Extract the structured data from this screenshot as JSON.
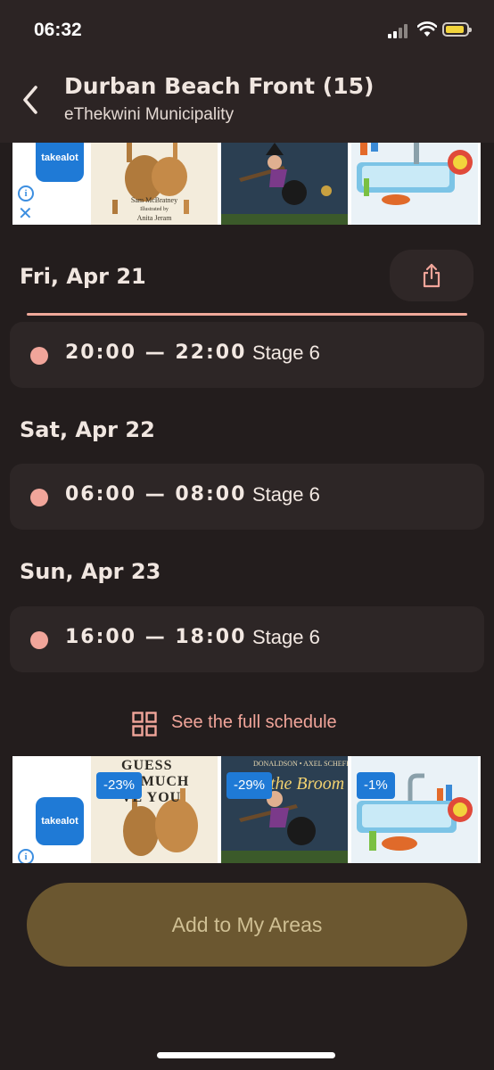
{
  "status_bar": {
    "time": "06:32"
  },
  "header": {
    "title": "Durban Beach Front (15)",
    "subtitle": "eThekwini Municipality"
  },
  "ads": {
    "brand": "takealot",
    "top": {
      "book1_title_lines": [
        "Sam McBratney",
        "Illustrated by",
        "Anita Jeram"
      ]
    },
    "bottom": {
      "book1_title": "GUESS\nW MUCH\nVE YOU",
      "book2_title": "n the Broom",
      "book2_authors": "DONALDSON • AXEL SCHEFFLER",
      "discounts": [
        "-23%",
        "-29%",
        "-1%"
      ]
    }
  },
  "schedule": {
    "days": [
      {
        "label": "Fri, Apr 21",
        "slots": [
          {
            "range": "20:00 — 22:00",
            "stage": "Stage 6"
          }
        ]
      },
      {
        "label": "Sat, Apr 22",
        "slots": [
          {
            "range": "06:00 — 08:00",
            "stage": "Stage 6"
          }
        ]
      },
      {
        "label": "Sun, Apr 23",
        "slots": [
          {
            "range": "16:00 — 18:00",
            "stage": "Stage 6"
          }
        ]
      }
    ],
    "full_schedule_label": "See the full schedule"
  },
  "actions": {
    "add_label": "Add to My Areas"
  },
  "icons": {
    "back": "chevron-left-icon",
    "share": "share-icon",
    "grid": "grid-icon",
    "ad_info": "info-icon",
    "ad_close": "close-icon"
  },
  "colors": {
    "background": "#231d1d",
    "header": "#2c2424",
    "accent": "#f1a59a",
    "button": "#6b5730",
    "button_text": "#cfbf93"
  }
}
